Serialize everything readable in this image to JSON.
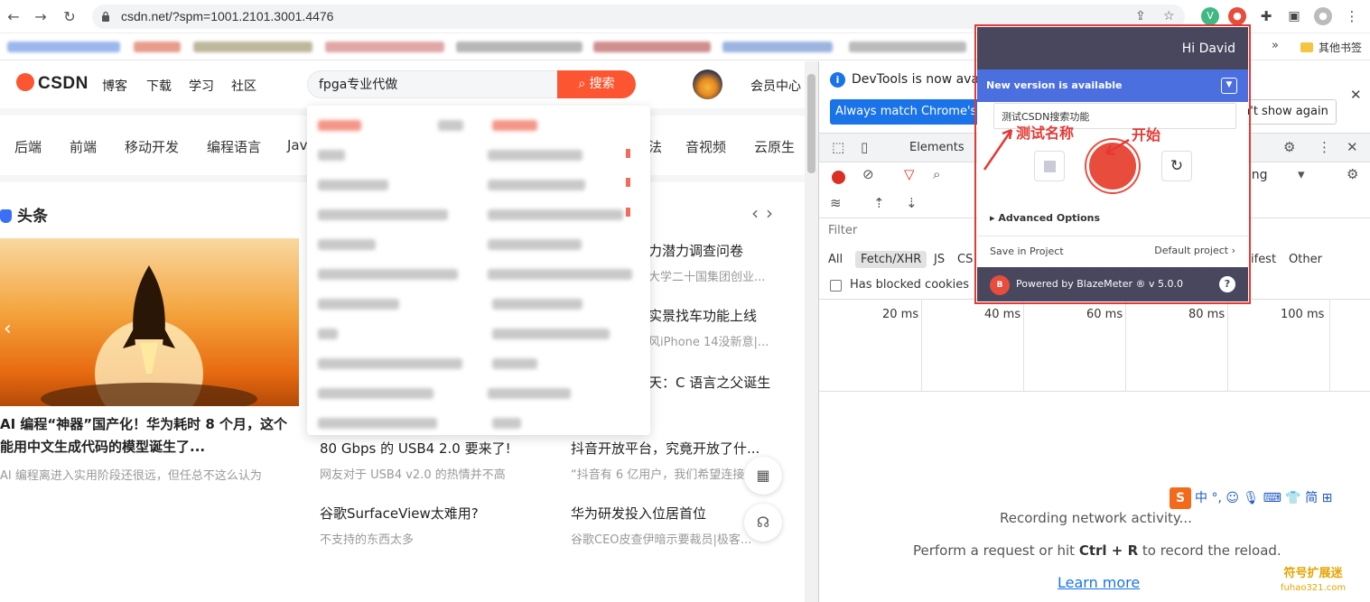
{
  "browser": {
    "url": "csdn.net/?spm=1001.2101.3001.4476",
    "other_bookmarks": "其他书签",
    "more_bookmarks": "»"
  },
  "csdn": {
    "nav": [
      "博客",
      "下载",
      "学习",
      "社区"
    ],
    "search": {
      "value": "fpga专业代做",
      "button": "搜索"
    },
    "member_center": "会员中心",
    "categories": [
      "后端",
      "前端",
      "移动开发",
      "编程语言",
      "Jav",
      "法",
      "音视频",
      "云原生"
    ],
    "headline_title": "头条",
    "hero": {
      "caption": "AI 编程“神器”国产化！华为耗时 8 个月，这个能用中文生成代码的模型诞生了...",
      "sub": "AI 编程离进入实用阶段还很远，但任总不这么认为"
    },
    "news_left": [
      {
        "title": "80 Gbps 的 USB4 2.0 要来了!",
        "sub": "网友对于 USB4 v2.0 的热情并不高"
      },
      {
        "title": "谷歌SurfaceView太难用?",
        "sub": "不支持的东西太多"
      }
    ],
    "news_right": [
      {
        "title": "力潜力调查问卷",
        "sub": "大学二十国集团创业..."
      },
      {
        "title": "实景找车功能上线",
        "sub": "风iPhone 14没新意|..."
      },
      {
        "title": "天：C 语言之父诞生",
        "sub": ""
      },
      {
        "title": "抖音开放平台，究竟开放了什...",
        "sub": "“抖音有 6 亿用户，我们希望连接"
      },
      {
        "title": "华为研发投入位居首位",
        "sub": "谷歌CEO皮查伊暗示要裁员|极客..."
      }
    ]
  },
  "devtools": {
    "info": "DevTools is now avai",
    "match_button": "Always match Chrome's",
    "dont_show": "n't show again",
    "elements_tab": "Elements",
    "throttling": "ttling",
    "filter_placeholder": "Filter",
    "types": [
      "All",
      "Fetch/XHR",
      "JS",
      "CS",
      "ifest",
      "Other"
    ],
    "blocked_cookies": "Has blocked cookies",
    "ticks": [
      "20 ms",
      "40 ms",
      "60 ms",
      "80 ms",
      "100 ms"
    ],
    "recording": "Recording network activity...",
    "hint_pre": "Perform a request or hit ",
    "hint_key": "Ctrl + R",
    "hint_post": " to record the reload.",
    "learn_more": "Learn more"
  },
  "blazemeter": {
    "greeting": "Hi David",
    "new_version": "New version is available",
    "test_name": "测试CSDN搜索功能",
    "advanced": "Advanced Options",
    "save_label": "Save in Project",
    "project": "Default project",
    "powered": "Powered by BlazeMeter ® v 5.0.0",
    "badge": "B",
    "help": "?"
  },
  "annotations": {
    "name_note": "测试名称",
    "start_note": "开始"
  },
  "ime": {
    "logo": "S",
    "text": "中 °, ☺ 🎙 ⌨ 👕 简 ⊞"
  },
  "watermark": {
    "line1": "符号扩展迷",
    "line2": "fuhao321.com"
  },
  "colors": {
    "csdn_red": "#fc5531",
    "chrome_blue": "#1a73e8",
    "blazemeter_dark": "#48475e",
    "blazemeter_blue": "#4c6fe0",
    "record_red": "#e84c3d"
  }
}
